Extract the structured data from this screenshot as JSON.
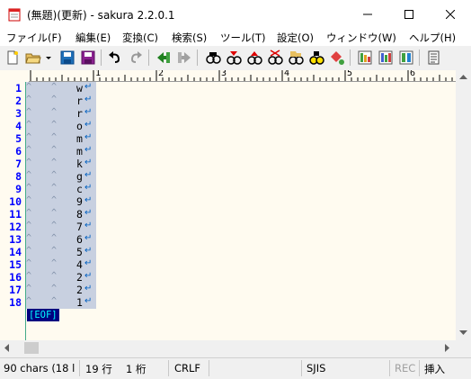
{
  "window": {
    "title": "(無題)(更新) - sakura 2.2.0.1"
  },
  "menu": {
    "items": [
      "ファイル(F)",
      "編集(E)",
      "変換(C)",
      "検索(S)",
      "ツール(T)",
      "設定(O)",
      "ウィンドウ(W)",
      "ヘルプ(H)"
    ]
  },
  "toolbar": {
    "icons": [
      "new-file-icon",
      "open-folder-icon",
      "dropdown-arrow-icon",
      "save-icon",
      "save-all-icon",
      "undo-icon",
      "redo-icon",
      "jump-back-icon",
      "jump-forward-icon",
      "search-icon",
      "search-next-icon",
      "search-prev-icon",
      "search-clear-icon",
      "grep-icon",
      "replace-icon",
      "tag-jump-icon",
      "outline-icon",
      "compare-icon",
      "macro-icon",
      "settings-icon"
    ]
  },
  "ruler": {
    "numbers": [
      "1",
      "2",
      "3",
      "4",
      "5",
      "6"
    ]
  },
  "editor": {
    "lines": [
      {
        "num": "1",
        "ch": "w"
      },
      {
        "num": "2",
        "ch": "r"
      },
      {
        "num": "3",
        "ch": "r"
      },
      {
        "num": "4",
        "ch": "o"
      },
      {
        "num": "5",
        "ch": "m"
      },
      {
        "num": "6",
        "ch": "m"
      },
      {
        "num": "7",
        "ch": "k"
      },
      {
        "num": "8",
        "ch": "g"
      },
      {
        "num": "9",
        "ch": "c"
      },
      {
        "num": "10",
        "ch": "9"
      },
      {
        "num": "11",
        "ch": "8"
      },
      {
        "num": "12",
        "ch": "7"
      },
      {
        "num": "13",
        "ch": "6"
      },
      {
        "num": "14",
        "ch": "5"
      },
      {
        "num": "15",
        "ch": "4"
      },
      {
        "num": "16",
        "ch": "2"
      },
      {
        "num": "17",
        "ch": "2"
      },
      {
        "num": "18",
        "ch": "1"
      }
    ],
    "tab_mark": "^",
    "newline_mark": "↵",
    "eof": "[EOF]"
  },
  "status": {
    "chars": "90 chars (18 l",
    "line": "19 行",
    "column": "1 桁",
    "newline": "CRLF",
    "encoding": "SJIS",
    "rec": "REC",
    "mode": "挿入"
  },
  "colors": {
    "background": "#fffbf0",
    "line_number": "#0000ff",
    "selection": "#c8d0e0",
    "eof_bg": "#000080",
    "eof_fg": "#00ffff"
  }
}
